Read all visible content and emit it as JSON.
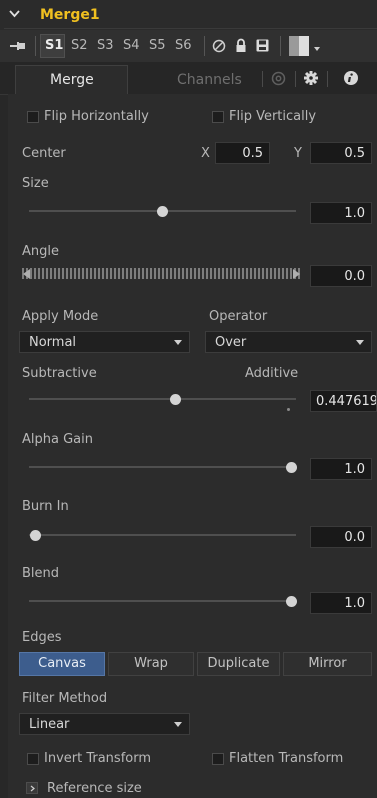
{
  "header": {
    "title": "Merge1"
  },
  "toolbar": {
    "scripts": [
      "S1",
      "S2",
      "S3",
      "S4",
      "S5",
      "S6"
    ],
    "active_script": "S1"
  },
  "tabs": [
    {
      "label": "Merge",
      "active": true
    },
    {
      "label": "Channels",
      "active": false
    }
  ],
  "tab_icons": [
    "settings-icon",
    "gear-icon",
    "info-icon"
  ],
  "flip": {
    "horizontal": "Flip Horizontally",
    "vertical": "Flip Vertically"
  },
  "center": {
    "label": "Center",
    "x_label": "X",
    "x_value": "0.5",
    "y_label": "Y",
    "y_value": "0.5"
  },
  "size": {
    "label": "Size",
    "value": "1.0",
    "slider": 0.5
  },
  "angle": {
    "label": "Angle",
    "value": "0.0"
  },
  "apply_mode": {
    "label": "Apply Mode",
    "value": "Normal"
  },
  "operator": {
    "label": "Operator",
    "value": "Over"
  },
  "sub_add": {
    "left_label": "Subtractive",
    "right_label": "Additive",
    "value": "0.447619",
    "slider": 0.55
  },
  "alpha_gain": {
    "label": "Alpha Gain",
    "value": "1.0",
    "slider": 1.0
  },
  "burn_in": {
    "label": "Burn In",
    "value": "0.0",
    "slider": 0.0
  },
  "blend": {
    "label": "Blend",
    "value": "1.0",
    "slider": 1.0
  },
  "edges": {
    "label": "Edges",
    "options": [
      "Canvas",
      "Wrap",
      "Duplicate",
      "Mirror"
    ],
    "selected": "Canvas"
  },
  "filter_method": {
    "label": "Filter Method",
    "value": "Linear"
  },
  "transform": {
    "invert": "Invert Transform",
    "flatten": "Flatten Transform"
  },
  "reference_size": {
    "label": "Reference size"
  },
  "colors": {
    "accent": "#f0c020",
    "selected": "#3d5d8d",
    "panel": "#2c2c2c",
    "field": "#191919"
  }
}
